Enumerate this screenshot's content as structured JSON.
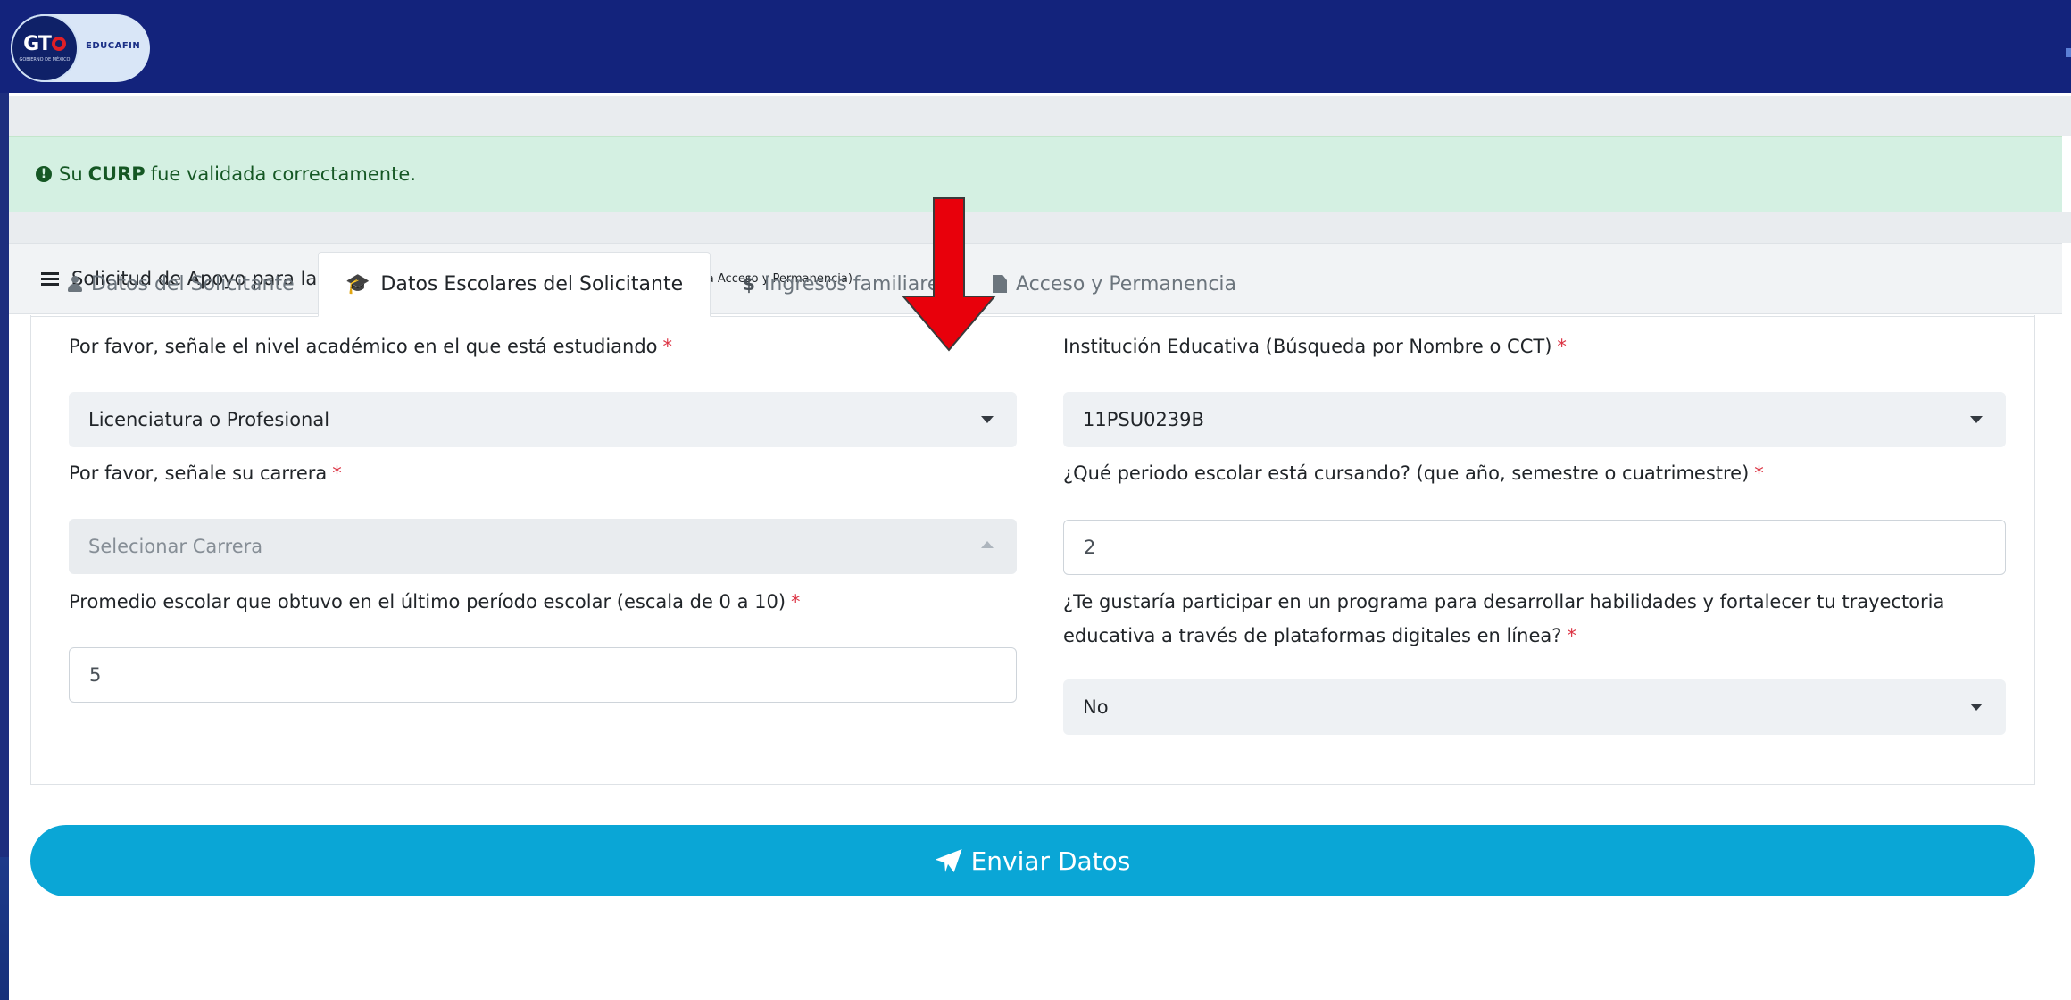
{
  "app": {
    "logo_text": "GTO",
    "logo_subtext": "GOBIERNO DE MÉXICO",
    "brand": "EDUCAFIN"
  },
  "alert": {
    "prefix": "Su",
    "strong": "CURP",
    "suffix": "fue validada correctamente."
  },
  "card": {
    "title": "Solicitud de Apoyo para la promoción del acceso y permanencia",
    "subtitle": "(Beca Acceso y Permanencia)"
  },
  "tabs": [
    {
      "label": "Datos del Solicitante",
      "icon": "user-icon",
      "active": false
    },
    {
      "label": "Datos Escolares del Solicitante",
      "icon": "graduation-cap-icon",
      "active": true
    },
    {
      "label": "Ingresos familiares",
      "icon": "dollar-icon",
      "active": false
    },
    {
      "label": "Acceso y Permanencia",
      "icon": "file-icon",
      "active": false
    }
  ],
  "form": {
    "nivel": {
      "label": "Por favor, señale el nivel académico en el que está estudiando",
      "value": "Licenciatura o Profesional"
    },
    "carrera": {
      "label": "Por favor, señale su carrera",
      "placeholder": "Selecionar Carrera"
    },
    "promedio": {
      "label": "Promedio escolar que obtuvo en el último período escolar (escala de 0 a 10)",
      "value": "5"
    },
    "institucion": {
      "label": "Institución Educativa (Búsqueda por Nombre o CCT)",
      "value": "11PSU0239B"
    },
    "periodo": {
      "label": "¿Qué periodo escolar está cursando? (que año, semestre o cuatrimestre)",
      "value": "2"
    },
    "programa": {
      "label_line1": "¿Te gustaría participar en un programa para desarrollar habilidades y fortalecer tu trayectoria",
      "label_line2": "educativa a través de plataformas digitales en línea?",
      "value": "No"
    },
    "required_mark": "*"
  },
  "submit": {
    "label": "Enviar Datos"
  },
  "colors": {
    "navbar": "#13237c",
    "alert_bg": "#d4f0e2",
    "alert_text": "#155724",
    "submit_bg": "#0aa6d6",
    "required": "#dc3545",
    "annotation_arrow": "#e8000b"
  }
}
